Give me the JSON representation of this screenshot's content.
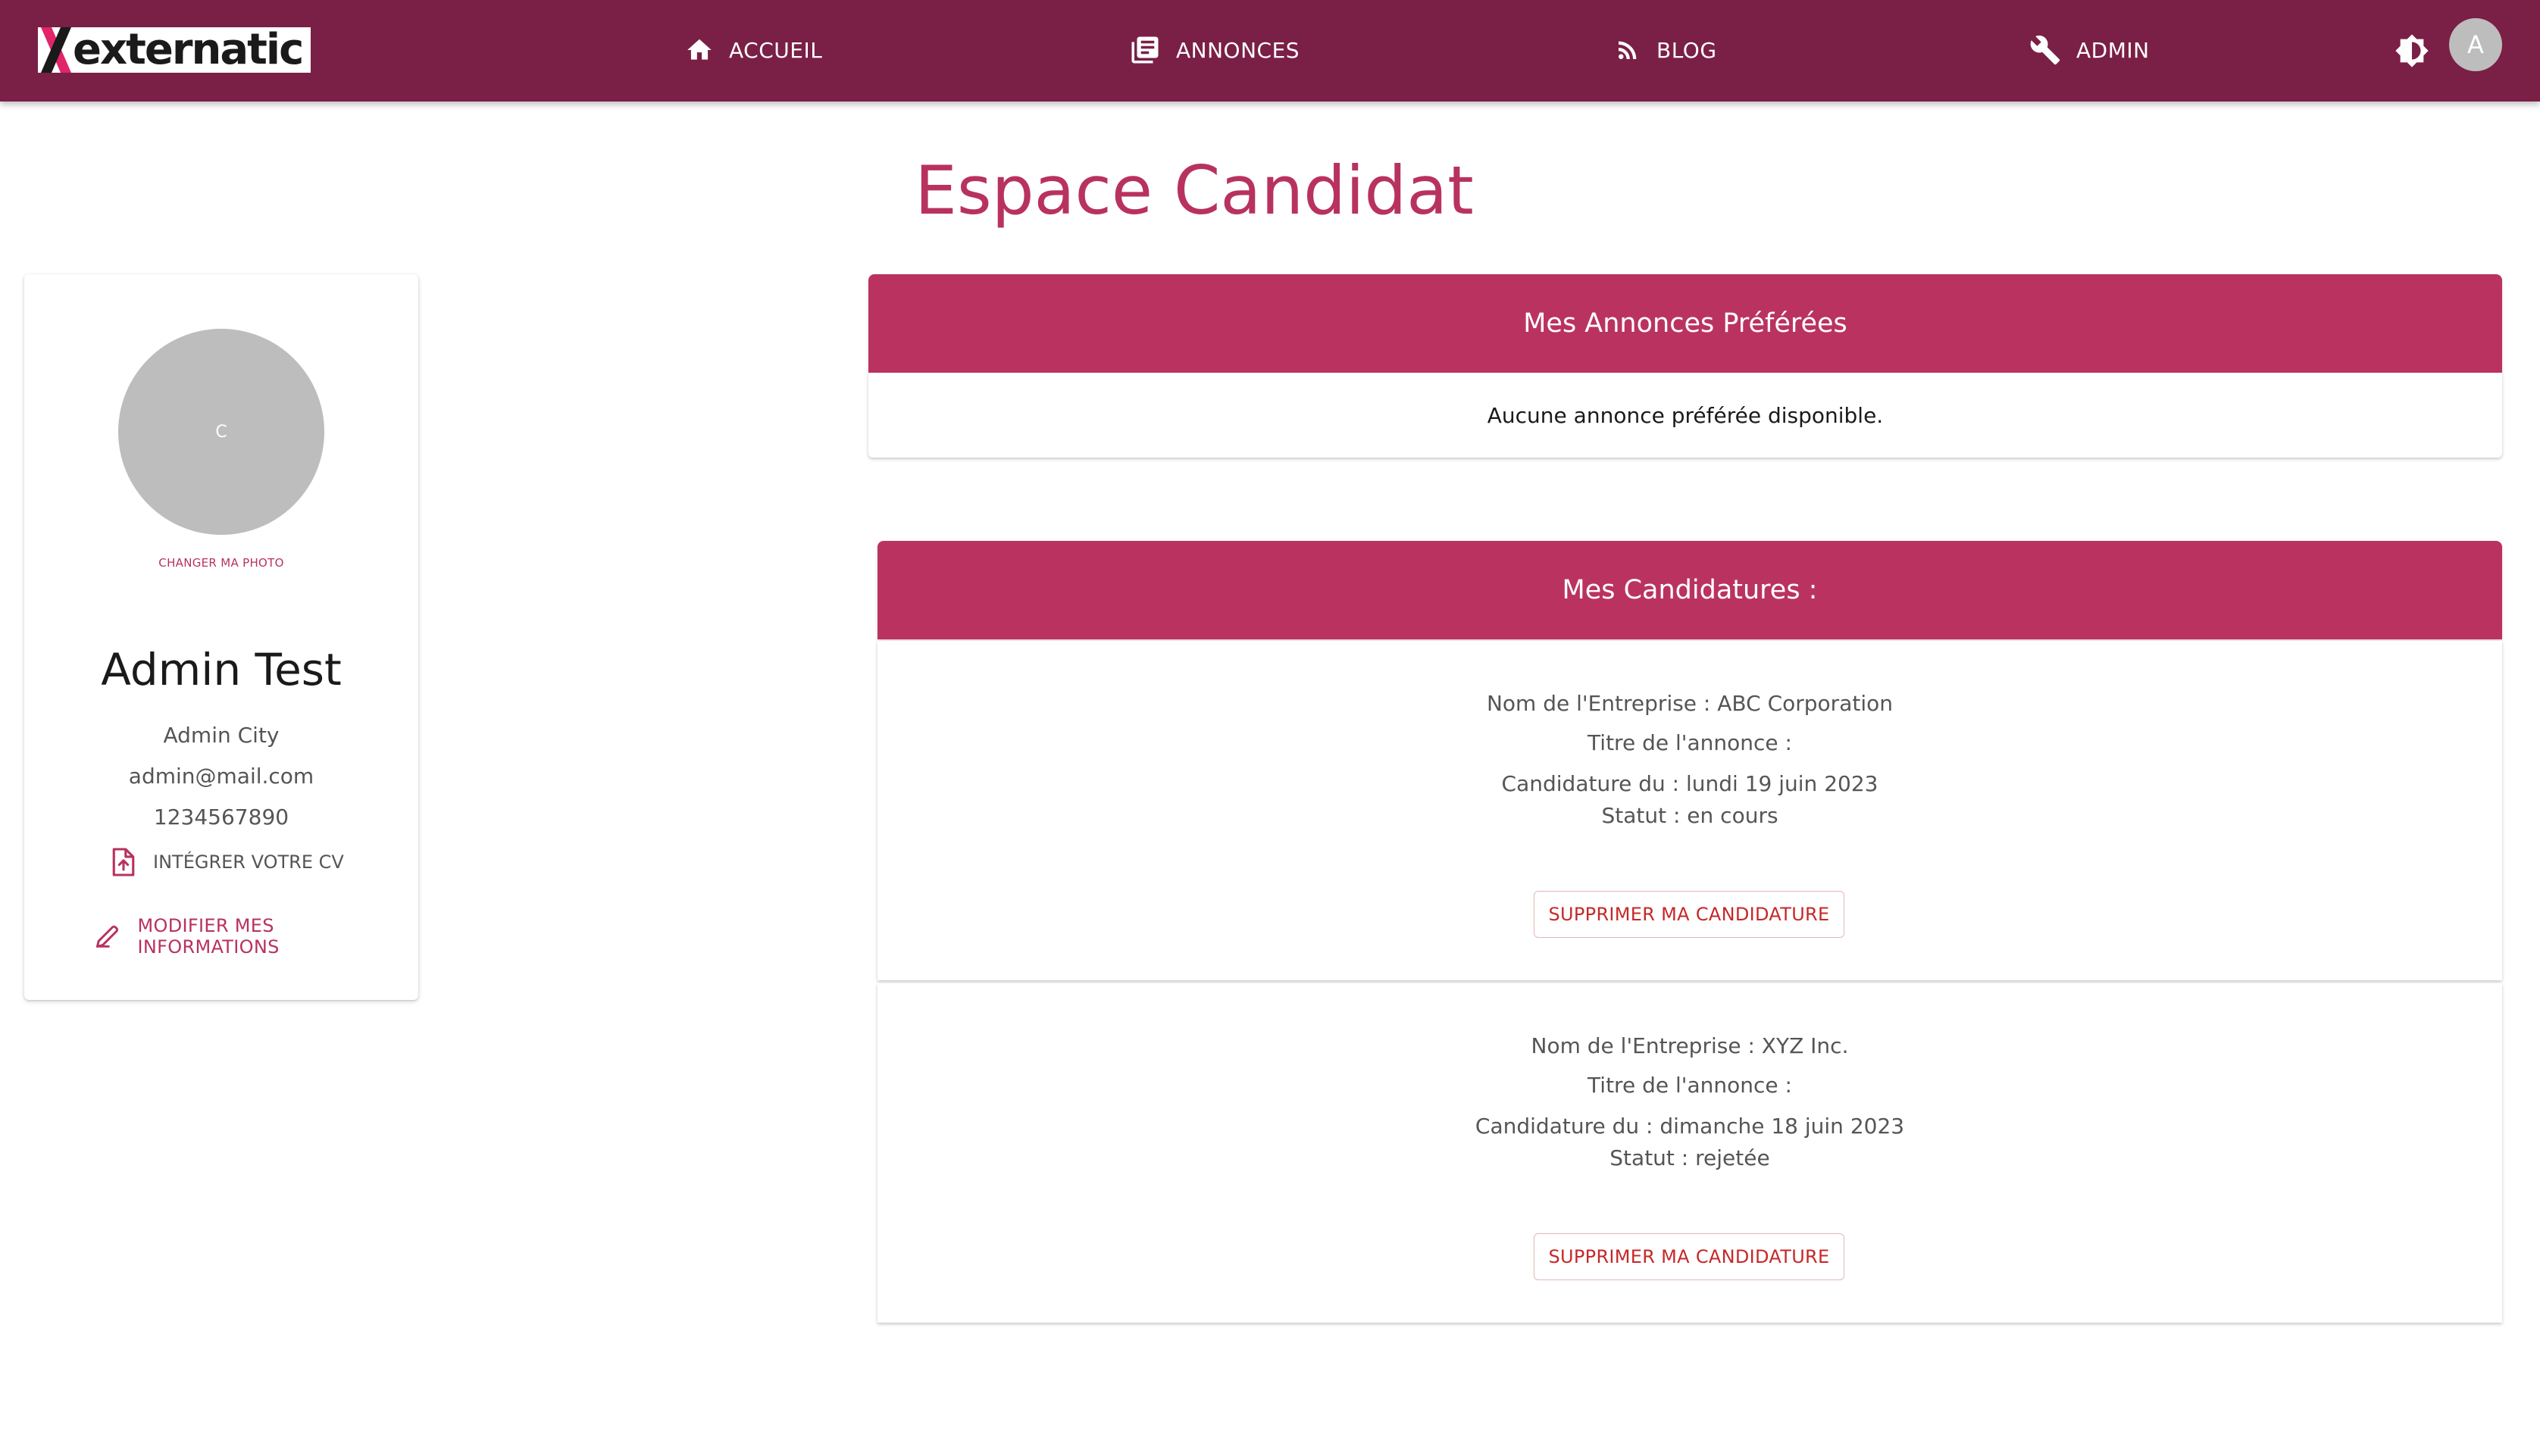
{
  "brand": {
    "logo_text": "externatic"
  },
  "nav": {
    "items": [
      {
        "label": "ACCUEIL",
        "icon": "home-icon"
      },
      {
        "label": "ANNONCES",
        "icon": "newspaper-icon"
      },
      {
        "label": "BLOG",
        "icon": "rss-icon"
      },
      {
        "label": "ADMIN",
        "icon": "wrench-icon"
      }
    ],
    "theme_icon": "brightness-icon",
    "user_initial": "A"
  },
  "page": {
    "title": "Espace Candidat"
  },
  "profile": {
    "avatar_initial": "C",
    "change_photo_label": "CHANGER MA PHOTO",
    "name": "Admin Test",
    "city": "Admin City",
    "email": "admin@mail.com",
    "phone": "1234567890",
    "cv_label": "INTÉGRER VOTRE CV",
    "modify_label": "MODIFIER MES INFORMATIONS"
  },
  "favorites": {
    "header": "Mes Annonces Préférées",
    "empty_text": "Aucune annonce préférée disponible."
  },
  "applications": {
    "header": "Mes Candidatures :",
    "items": [
      {
        "company": "Nom de l'Entreprise : ABC Corporation",
        "title": "Titre de l'annonce :",
        "date": "Candidature du : lundi 19 juin 2023",
        "status": "Statut : en cours",
        "delete_label": "SUPPRIMER MA CANDIDATURE"
      },
      {
        "company": "Nom de l'Entreprise : XYZ Inc.",
        "title": "Titre de l'annonce :",
        "date": "Candidature du : dimanche 18 juin 2023",
        "status": "Statut : rejetée",
        "delete_label": "SUPPRIMER MA CANDIDATURE"
      }
    ]
  },
  "colors": {
    "navbar": "#7a1f45",
    "accent": "#ba3360",
    "danger": "#c62828"
  }
}
